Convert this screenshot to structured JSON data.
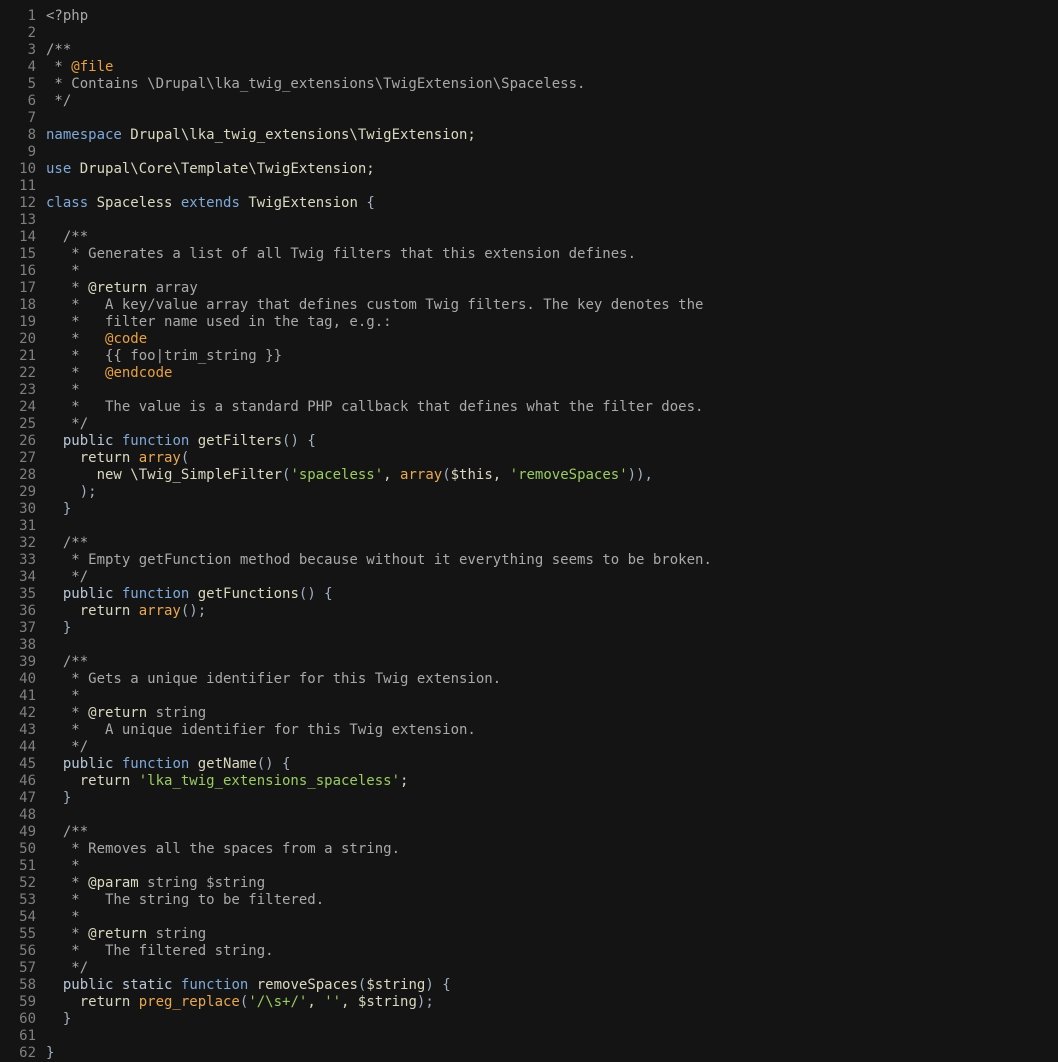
{
  "editor": {
    "language": "php",
    "lines": [
      {
        "n": "1",
        "segments": [
          {
            "t": "<?php",
            "c": "cmt"
          }
        ]
      },
      {
        "n": "2",
        "segments": []
      },
      {
        "n": "3",
        "segments": [
          {
            "t": "/**",
            "c": "cmt"
          }
        ]
      },
      {
        "n": "4",
        "segments": [
          {
            "t": " * ",
            "c": "cmt"
          },
          {
            "t": "@file",
            "c": "tag"
          }
        ]
      },
      {
        "n": "5",
        "segments": [
          {
            "t": " * Contains \\Drupal\\lka_twig_extensions\\TwigExtension\\Spaceless.",
            "c": "cmt"
          }
        ]
      },
      {
        "n": "6",
        "segments": [
          {
            "t": " */",
            "c": "cmt"
          }
        ]
      },
      {
        "n": "7",
        "segments": []
      },
      {
        "n": "8",
        "segments": [
          {
            "t": "namespace",
            "c": "kw"
          },
          {
            "t": " Drupal\\lka_twig_extensions\\TwigExtension;",
            "c": "fn"
          }
        ]
      },
      {
        "n": "9",
        "segments": []
      },
      {
        "n": "10",
        "segments": [
          {
            "t": "use",
            "c": "kw"
          },
          {
            "t": " Drupal\\Core\\Template\\TwigExtension;",
            "c": "fn"
          }
        ]
      },
      {
        "n": "11",
        "segments": []
      },
      {
        "n": "12",
        "segments": [
          {
            "t": "class",
            "c": "kw"
          },
          {
            "t": " Spaceless ",
            "c": "fn"
          },
          {
            "t": "extends",
            "c": "kw"
          },
          {
            "t": " TwigExtension ",
            "c": "fn"
          },
          {
            "t": "{",
            "c": "op"
          }
        ]
      },
      {
        "n": "13",
        "segments": []
      },
      {
        "n": "14",
        "segments": [
          {
            "t": "  /**",
            "c": "cmt"
          }
        ]
      },
      {
        "n": "15",
        "segments": [
          {
            "t": "   * Generates a list of all Twig filters that this extension defines.",
            "c": "cmt"
          }
        ]
      },
      {
        "n": "16",
        "segments": [
          {
            "t": "   *",
            "c": "cmt"
          }
        ]
      },
      {
        "n": "17",
        "segments": [
          {
            "t": "   * ",
            "c": "cmt"
          },
          {
            "t": "@return",
            "c": "fn"
          },
          {
            "t": " array",
            "c": "cmt"
          }
        ]
      },
      {
        "n": "18",
        "segments": [
          {
            "t": "   *   A key/value array that defines custom Twig filters. The key denotes the",
            "c": "cmt"
          }
        ]
      },
      {
        "n": "19",
        "segments": [
          {
            "t": "   *   filter name used in the tag, e.g.:",
            "c": "cmt"
          }
        ]
      },
      {
        "n": "20",
        "segments": [
          {
            "t": "   *   ",
            "c": "cmt"
          },
          {
            "t": "@code",
            "c": "tag"
          }
        ]
      },
      {
        "n": "21",
        "segments": [
          {
            "t": "   *   {{ foo|trim_string }}",
            "c": "cmt"
          }
        ]
      },
      {
        "n": "22",
        "segments": [
          {
            "t": "   *   ",
            "c": "cmt"
          },
          {
            "t": "@endcode",
            "c": "tag"
          }
        ]
      },
      {
        "n": "23",
        "segments": [
          {
            "t": "   *",
            "c": "cmt"
          }
        ]
      },
      {
        "n": "24",
        "segments": [
          {
            "t": "   *   The value is a standard PHP callback that defines what the filter does.",
            "c": "cmt"
          }
        ]
      },
      {
        "n": "25",
        "segments": [
          {
            "t": "   */",
            "c": "cmt"
          }
        ]
      },
      {
        "n": "26",
        "segments": [
          {
            "t": "  public",
            "c": "typ"
          },
          {
            "t": " ",
            "c": "fn"
          },
          {
            "t": "function",
            "c": "kw"
          },
          {
            "t": " getFilters",
            "c": "fn"
          },
          {
            "t": "() {",
            "c": "op"
          }
        ]
      },
      {
        "n": "27",
        "segments": [
          {
            "t": "    return ",
            "c": "fn"
          },
          {
            "t": "array",
            "c": "arr"
          },
          {
            "t": "(",
            "c": "op"
          }
        ]
      },
      {
        "n": "28",
        "segments": [
          {
            "t": "      new \\Twig_SimpleFilter",
            "c": "fn"
          },
          {
            "t": "(",
            "c": "op"
          },
          {
            "t": "'spaceless'",
            "c": "str"
          },
          {
            "t": ", ",
            "c": "fn"
          },
          {
            "t": "array",
            "c": "arr"
          },
          {
            "t": "(",
            "c": "op"
          },
          {
            "t": "$this",
            "c": "var"
          },
          {
            "t": ", ",
            "c": "fn"
          },
          {
            "t": "'removeSpaces'",
            "c": "str"
          },
          {
            "t": ")),",
            "c": "op"
          }
        ]
      },
      {
        "n": "29",
        "segments": [
          {
            "t": "    );",
            "c": "op"
          }
        ]
      },
      {
        "n": "30",
        "segments": [
          {
            "t": "  }",
            "c": "op"
          }
        ]
      },
      {
        "n": "31",
        "segments": []
      },
      {
        "n": "32",
        "segments": [
          {
            "t": "  /**",
            "c": "cmt"
          }
        ]
      },
      {
        "n": "33",
        "segments": [
          {
            "t": "   * Empty getFunction method because without it everything seems to be broken.",
            "c": "cmt"
          }
        ]
      },
      {
        "n": "34",
        "segments": [
          {
            "t": "   */",
            "c": "cmt"
          }
        ]
      },
      {
        "n": "35",
        "segments": [
          {
            "t": "  public",
            "c": "typ"
          },
          {
            "t": " ",
            "c": "fn"
          },
          {
            "t": "function",
            "c": "kw"
          },
          {
            "t": " getFunctions",
            "c": "fn"
          },
          {
            "t": "() {",
            "c": "op"
          }
        ]
      },
      {
        "n": "36",
        "segments": [
          {
            "t": "    return ",
            "c": "fn"
          },
          {
            "t": "array",
            "c": "arr"
          },
          {
            "t": "();",
            "c": "op"
          }
        ]
      },
      {
        "n": "37",
        "segments": [
          {
            "t": "  }",
            "c": "op"
          }
        ]
      },
      {
        "n": "38",
        "segments": []
      },
      {
        "n": "39",
        "segments": [
          {
            "t": "  /**",
            "c": "cmt"
          }
        ]
      },
      {
        "n": "40",
        "segments": [
          {
            "t": "   * Gets a unique identifier for this Twig extension.",
            "c": "cmt"
          }
        ]
      },
      {
        "n": "41",
        "segments": [
          {
            "t": "   *",
            "c": "cmt"
          }
        ]
      },
      {
        "n": "42",
        "segments": [
          {
            "t": "   * ",
            "c": "cmt"
          },
          {
            "t": "@return",
            "c": "fn"
          },
          {
            "t": " string",
            "c": "cmt"
          }
        ]
      },
      {
        "n": "43",
        "segments": [
          {
            "t": "   *   A unique identifier for this Twig extension.",
            "c": "cmt"
          }
        ]
      },
      {
        "n": "44",
        "segments": [
          {
            "t": "   */",
            "c": "cmt"
          }
        ]
      },
      {
        "n": "45",
        "segments": [
          {
            "t": "  public",
            "c": "typ"
          },
          {
            "t": " ",
            "c": "fn"
          },
          {
            "t": "function",
            "c": "kw"
          },
          {
            "t": " getName",
            "c": "fn"
          },
          {
            "t": "() {",
            "c": "op"
          }
        ]
      },
      {
        "n": "46",
        "segments": [
          {
            "t": "    return ",
            "c": "fn"
          },
          {
            "t": "'lka_twig_extensions_spaceless'",
            "c": "str"
          },
          {
            "t": ";",
            "c": "fn"
          }
        ]
      },
      {
        "n": "47",
        "segments": [
          {
            "t": "  }",
            "c": "op"
          }
        ]
      },
      {
        "n": "48",
        "segments": []
      },
      {
        "n": "49",
        "segments": [
          {
            "t": "  /**",
            "c": "cmt"
          }
        ]
      },
      {
        "n": "50",
        "segments": [
          {
            "t": "   * Removes all the spaces from a string.",
            "c": "cmt"
          }
        ]
      },
      {
        "n": "51",
        "segments": [
          {
            "t": "   *",
            "c": "cmt"
          }
        ]
      },
      {
        "n": "52",
        "segments": [
          {
            "t": "   * ",
            "c": "cmt"
          },
          {
            "t": "@param",
            "c": "fn"
          },
          {
            "t": " string $string",
            "c": "cmt"
          }
        ]
      },
      {
        "n": "53",
        "segments": [
          {
            "t": "   *   The string to be filtered.",
            "c": "cmt"
          }
        ]
      },
      {
        "n": "54",
        "segments": [
          {
            "t": "   *",
            "c": "cmt"
          }
        ]
      },
      {
        "n": "55",
        "segments": [
          {
            "t": "   * ",
            "c": "cmt"
          },
          {
            "t": "@return",
            "c": "fn"
          },
          {
            "t": " string",
            "c": "cmt"
          }
        ]
      },
      {
        "n": "56",
        "segments": [
          {
            "t": "   *   The filtered string.",
            "c": "cmt"
          }
        ]
      },
      {
        "n": "57",
        "segments": [
          {
            "t": "   */",
            "c": "cmt"
          }
        ]
      },
      {
        "n": "58",
        "segments": [
          {
            "t": "  public",
            "c": "typ"
          },
          {
            "t": " ",
            "c": "fn"
          },
          {
            "t": "static",
            "c": "typ"
          },
          {
            "t": " ",
            "c": "fn"
          },
          {
            "t": "function",
            "c": "kw"
          },
          {
            "t": " removeSpaces",
            "c": "fn"
          },
          {
            "t": "(",
            "c": "op"
          },
          {
            "t": "$string",
            "c": "var"
          },
          {
            "t": ") {",
            "c": "op"
          }
        ]
      },
      {
        "n": "59",
        "segments": [
          {
            "t": "    return ",
            "c": "fn"
          },
          {
            "t": "preg_replace",
            "c": "arr"
          },
          {
            "t": "(",
            "c": "op"
          },
          {
            "t": "'/\\s+/'",
            "c": "str"
          },
          {
            "t": ", ",
            "c": "fn"
          },
          {
            "t": "''",
            "c": "str"
          },
          {
            "t": ", ",
            "c": "fn"
          },
          {
            "t": "$string",
            "c": "var"
          },
          {
            "t": ");",
            "c": "op"
          }
        ]
      },
      {
        "n": "60",
        "segments": [
          {
            "t": "  }",
            "c": "op"
          }
        ]
      },
      {
        "n": "61",
        "segments": []
      },
      {
        "n": "62",
        "segments": [
          {
            "t": "}",
            "c": "op"
          }
        ]
      }
    ]
  }
}
